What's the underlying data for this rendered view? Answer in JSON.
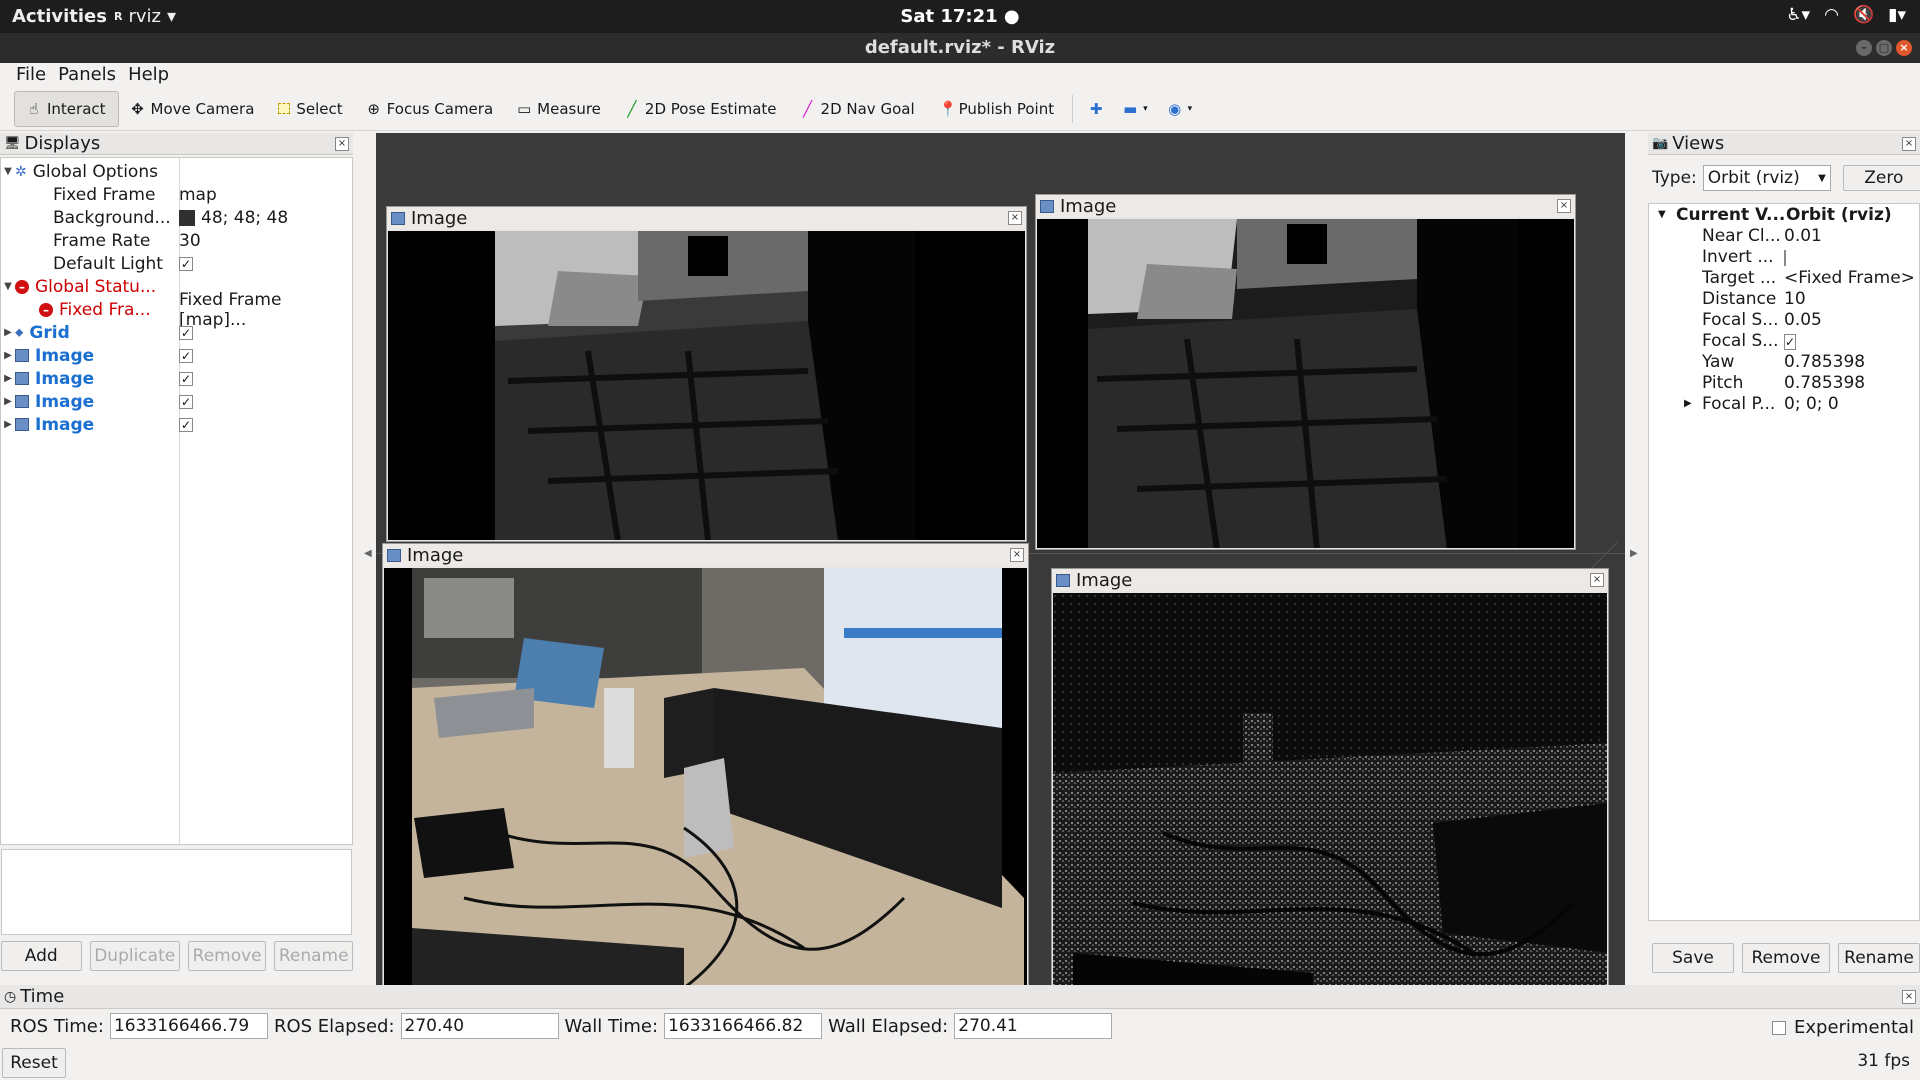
{
  "system": {
    "activities": "Activities",
    "app_menu": "rviz",
    "clock": "Sat 17:21 ●"
  },
  "window": {
    "title": "default.rviz* - RViz"
  },
  "menu": [
    "File",
    "Panels",
    "Help"
  ],
  "toolbar": {
    "interact": "Interact",
    "move_camera": "Move Camera",
    "select": "Select",
    "focus_camera": "Focus Camera",
    "measure": "Measure",
    "pose_estimate": "2D Pose Estimate",
    "nav_goal": "2D Nav Goal",
    "publish_point": "Publish Point"
  },
  "displays": {
    "title": "Displays",
    "global_options": "Global Options",
    "fixed_frame_label": "Fixed Frame",
    "fixed_frame_value": "map",
    "background_label": "Background...",
    "background_value": "48; 48; 48",
    "frame_rate_label": "Frame Rate",
    "frame_rate_value": "30",
    "default_light_label": "Default Light",
    "global_status": "Global Statu...",
    "fixed_frame_status": "Fixed Fra...",
    "fixed_frame_status_value": "Fixed Frame [map]...",
    "grid": "Grid",
    "image": "Image",
    "buttons": {
      "add": "Add",
      "duplicate": "Duplicate",
      "remove": "Remove",
      "rename": "Rename"
    }
  },
  "image_windows": {
    "title": "Image"
  },
  "views": {
    "title": "Views",
    "type_label": "Type:",
    "type_value": "Orbit (rviz)",
    "zero": "Zero",
    "current_view": "Current V...",
    "current_view_value": "Orbit (rviz)",
    "props": [
      {
        "k": "Near Cl...",
        "v": "0.01"
      },
      {
        "k": "Invert ...",
        "v": ""
      },
      {
        "k": "Target ...",
        "v": "<Fixed Frame>"
      },
      {
        "k": "Distance",
        "v": "10"
      },
      {
        "k": "Focal S...",
        "v": "0.05"
      },
      {
        "k": "Focal S...",
        "v": ""
      },
      {
        "k": "Yaw",
        "v": "0.785398"
      },
      {
        "k": "Pitch",
        "v": "0.785398"
      },
      {
        "k": "Focal P...",
        "v": "0; 0; 0"
      }
    ],
    "buttons": {
      "save": "Save",
      "remove": "Remove",
      "rename": "Rename"
    }
  },
  "time": {
    "title": "Time",
    "ros_time_label": "ROS Time:",
    "ros_time_value": "1633166466.79",
    "ros_elapsed_label": "ROS Elapsed:",
    "ros_elapsed_value": "270.40",
    "wall_time_label": "Wall Time:",
    "wall_time_value": "1633166466.82",
    "wall_elapsed_label": "Wall Elapsed:",
    "wall_elapsed_value": "270.41",
    "experimental": "Experimental",
    "reset": "Reset",
    "fps": "31 fps"
  },
  "colors": {
    "background_swatch": "#303030",
    "error_red": "#cc0000",
    "link_blue": "#1a6fd0"
  }
}
